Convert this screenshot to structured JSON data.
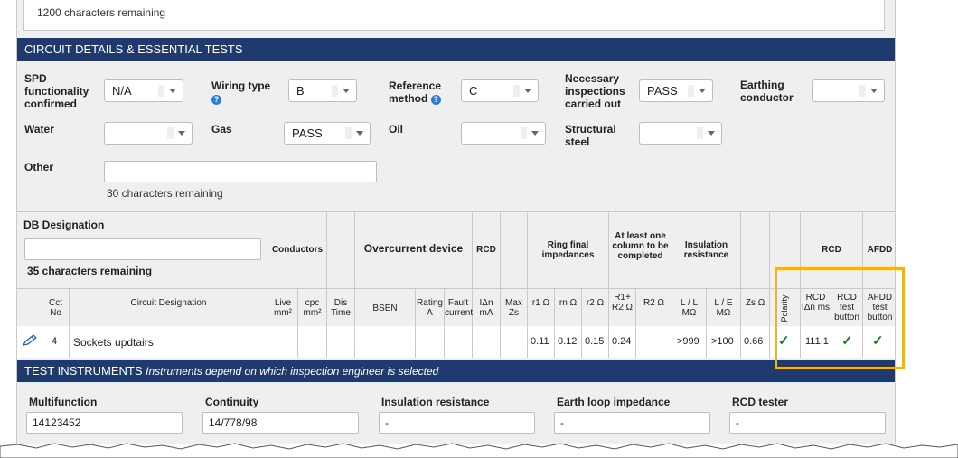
{
  "top": {
    "remaining": "1200 characters remaining"
  },
  "circuit_section": {
    "header": "CIRCUIT DETAILS & ESSENTIAL TESTS",
    "spd": {
      "label": "SPD functionality confirmed",
      "value": "N/A"
    },
    "wiring": {
      "label": "Wiring type",
      "value": "B"
    },
    "reference": {
      "label": "Reference method",
      "value": "C"
    },
    "necessary": {
      "label": "Necessary inspections carried out",
      "value": "PASS"
    },
    "earthing": {
      "label": "Earthing conductor",
      "value": ""
    },
    "water": {
      "label": "Water",
      "value": ""
    },
    "gas": {
      "label": "Gas",
      "value": "PASS"
    },
    "oil": {
      "label": "Oil",
      "value": ""
    },
    "structural": {
      "label": "Structural steel",
      "value": ""
    },
    "other": {
      "label": "Other",
      "value": "",
      "remaining": "30 characters remaining"
    }
  },
  "db": {
    "label": "DB Designation",
    "value": "",
    "remaining": "35 characters remaining"
  },
  "group_headers": {
    "conductors": "Conductors",
    "overcurrent": "Overcurrent device",
    "rcd": "RCD",
    "ring": "Ring final impedances",
    "atleast": "At least one column to be completed",
    "insulation": "Insulation resistance",
    "rcd2": "RCD",
    "afdd": "AFDD"
  },
  "columns": {
    "cct": "Cct No",
    "designation": "Circuit Designation",
    "live": "Live mm²",
    "cpc": "cpc mm²",
    "dis": "Dis Time",
    "bsen": "BSEN",
    "rating": "Rating A",
    "fault": "Fault current",
    "idn": "IΔn mA",
    "maxzs": "Max Zs",
    "r1": "r1 Ω",
    "rn": "rn Ω",
    "r2": "r2 Ω",
    "r1r2": "R1+ R2 Ω",
    "R2": "R2 Ω",
    "ll": "L / L MΩ",
    "le": "L / E MΩ",
    "zs": "Zs Ω",
    "polarity": "Polarity",
    "rcdidn": "RCD IΔn ms",
    "rcdtest": "RCD test button",
    "afddtest": "AFDD test button"
  },
  "row": {
    "cct": "4",
    "designation": "Sockets updtairs",
    "r1": "0.11",
    "rn": "0.12",
    "r2": "0.15",
    "r1r2": "0.24",
    "ll": ">999",
    "le": ">100",
    "zs": "0.66",
    "polarity": "✓",
    "rcdidn": "111.1",
    "rcdtest": "✓",
    "afddtest": "✓"
  },
  "instruments": {
    "header": "TEST INSTRUMENTS",
    "header_note": "Instruments depend on which inspection engineer is selected",
    "multifunction": {
      "label": "Multifunction",
      "value": "14123452"
    },
    "continuity": {
      "label": "Continuity",
      "value": "14/778/98"
    },
    "insulation": {
      "label": "Insulation resistance",
      "value": "-"
    },
    "earthloop": {
      "label": "Earth loop impedance",
      "value": "-"
    },
    "rcdtester": {
      "label": "RCD tester",
      "value": "-"
    }
  },
  "colors": {
    "header_bg": "#1e3a6e",
    "highlight": "#f2b31a",
    "check": "#1a7a1a"
  }
}
